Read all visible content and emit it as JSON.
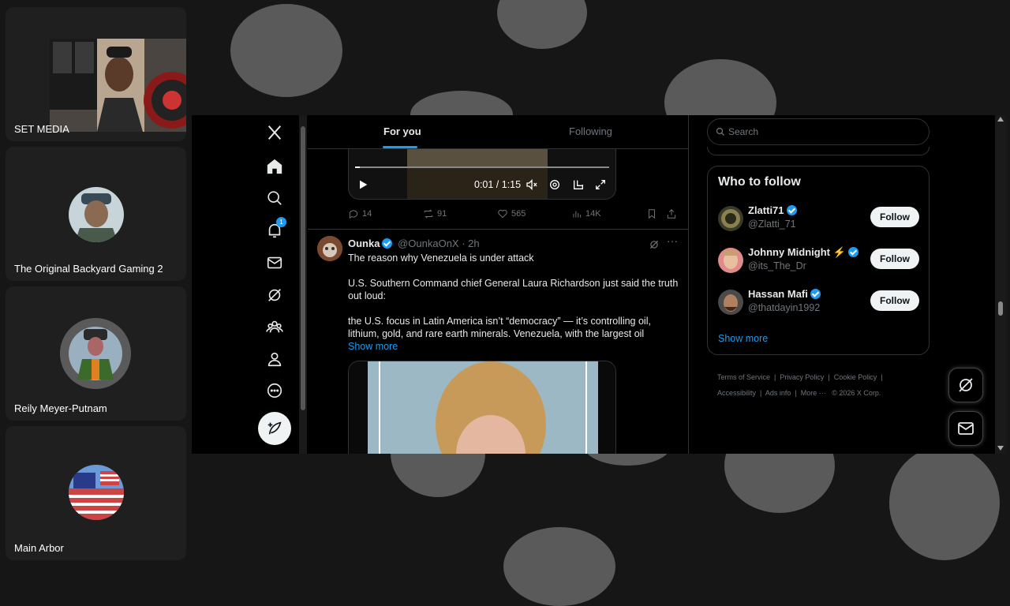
{
  "participants": [
    {
      "name": "SET MEDIA",
      "badge_text": "S.E.T MEDIA"
    },
    {
      "name": "The Original Backyard Gaming 2"
    },
    {
      "name": "Reily Meyer-Putnam"
    },
    {
      "name": "Main Arbor"
    }
  ],
  "nav": {
    "notification_count": "1",
    "items": [
      "x-logo",
      "home",
      "explore",
      "notifications",
      "messages",
      "grok",
      "communities",
      "profile",
      "more",
      "post"
    ]
  },
  "tabs": {
    "for_you": "For you",
    "following": "Following"
  },
  "video": {
    "time": "0:01 / 1:15"
  },
  "prev_post_actions": {
    "replies": "14",
    "reposts": "91",
    "likes": "565",
    "views": "14K"
  },
  "post": {
    "author": "Ounka",
    "handle": "@OunkaOnX",
    "time": "· 2h",
    "line1": "The reason why Venezuela is under attack",
    "line2": "U.S. Southern Command chief General Laura Richardson just said the truth out loud:",
    "line3": "the U.S. focus in Latin America isn’t “democracy” — it’s controlling oil, lithium, gold, and rare earth minerals. Venezuela, with the largest oil",
    "show_more": "Show more"
  },
  "search": {
    "placeholder": "Search"
  },
  "who_to_follow": {
    "title": "Who to follow",
    "accounts": [
      {
        "name": "Zlatti71",
        "handle": "@Zlatti_71",
        "follow": "Follow"
      },
      {
        "name": "Johnny Midnight ⚡",
        "handle": "@its_The_Dr",
        "follow": "Follow"
      },
      {
        "name": "Hassan Mafi",
        "handle": "@thatdayin1992",
        "follow": "Follow"
      }
    ],
    "show_more": "Show more"
  },
  "footer": {
    "terms": "Terms of Service",
    "privacy": "Privacy Policy",
    "cookie": "Cookie Policy",
    "accessibility": "Accessibility",
    "ads": "Ads info",
    "more": "More ···",
    "copyright": "© 2026 X Corp."
  },
  "colors": {
    "accent": "#1d9bf0",
    "background": "#000000",
    "text": "#e7e9ea",
    "muted": "#71767b"
  }
}
